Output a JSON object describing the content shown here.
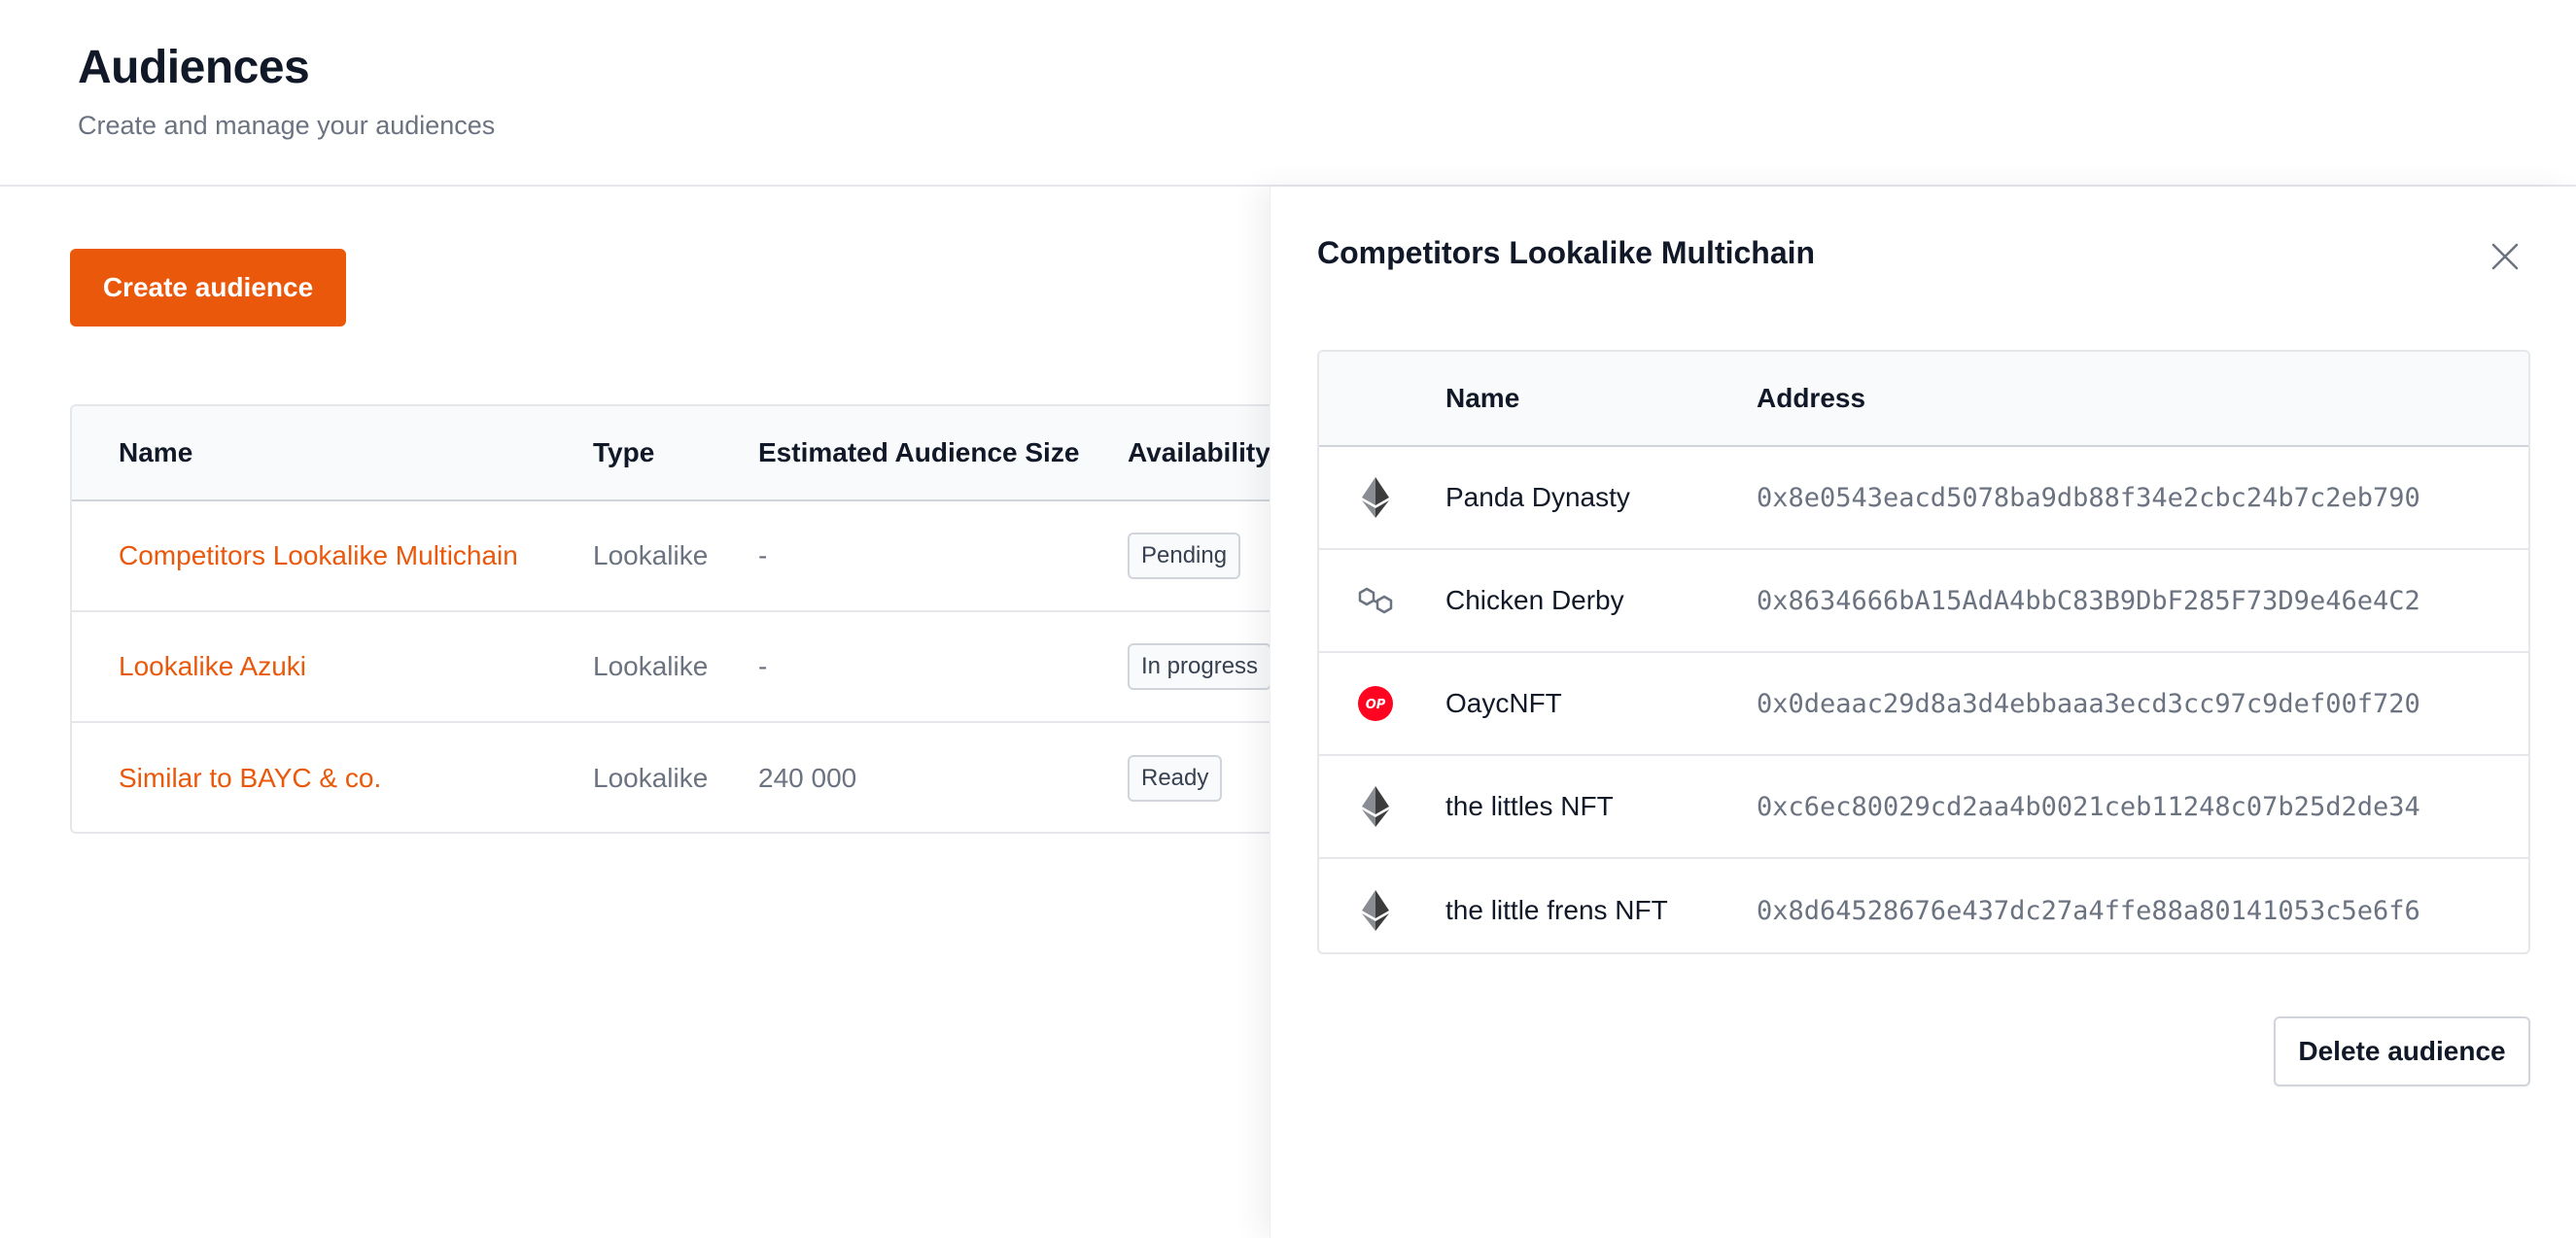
{
  "header": {
    "title": "Audiences",
    "subtitle": "Create and manage your audiences"
  },
  "main": {
    "create_button_label": "Create audience",
    "table": {
      "columns": [
        "Name",
        "Type",
        "Estimated Audience Size",
        "Availability"
      ],
      "rows": [
        {
          "name": "Competitors Lookalike Multichain",
          "type": "Lookalike",
          "size": "-",
          "availability": "Pending"
        },
        {
          "name": "Lookalike Azuki",
          "type": "Lookalike",
          "size": "-",
          "availability": "In progress"
        },
        {
          "name": "Similar to BAYC & co.",
          "type": "Lookalike",
          "size": "240 000",
          "availability": "Ready"
        }
      ]
    }
  },
  "drawer": {
    "title": "Competitors Lookalike Multichain",
    "close_icon": "close-icon",
    "table": {
      "columns": [
        "Name",
        "Address"
      ],
      "rows": [
        {
          "chain_icon": "ethereum-icon",
          "name": "Panda Dynasty",
          "address": "0x8e0543eacd5078ba9db88f34e2cbc24b7c2eb790"
        },
        {
          "chain_icon": "polygon-icon",
          "name": "Chicken Derby",
          "address": "0x8634666bA15AdA4bbC83B9DbF285F73D9e46e4C2"
        },
        {
          "chain_icon": "optimism-icon",
          "name": "OaycNFT",
          "address": "0x0deaac29d8a3d4ebbaaa3ecd3cc97c9def00f720"
        },
        {
          "chain_icon": "ethereum-icon",
          "name": "the littles NFT",
          "address": "0xc6ec80029cd2aa4b0021ceb11248c07b25d2de34"
        },
        {
          "chain_icon": "ethereum-icon",
          "name": "the little frens NFT",
          "address": "0x8d64528676e437dc27a4ffe88a80141053c5e6f6"
        }
      ]
    },
    "delete_button_label": "Delete audience",
    "colors": {
      "accent": "#ea580c",
      "optimism": "#ff0420",
      "eth_dark": "#3c3c3d",
      "eth_light": "#8a8c94"
    }
  },
  "icons": {
    "optimism_glyph": "OP"
  }
}
